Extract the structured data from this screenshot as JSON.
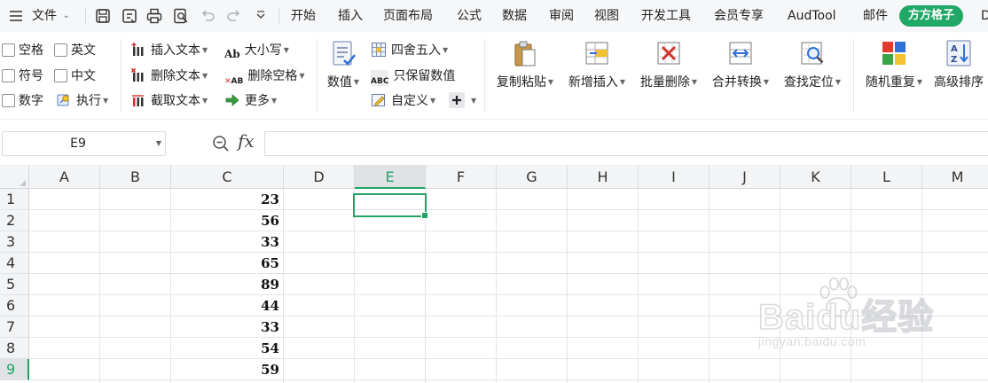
{
  "menubar": {
    "file_menu_label": "文件",
    "tabs": [
      {
        "label": "开始"
      },
      {
        "label": "插入"
      },
      {
        "label": "页面布局"
      },
      {
        "label": "公式"
      },
      {
        "label": "数据"
      },
      {
        "label": "审阅"
      },
      {
        "label": "视图"
      },
      {
        "label": "开发工具"
      },
      {
        "label": "会员专享"
      },
      {
        "label": "AudTool"
      },
      {
        "label": "邮件"
      }
    ],
    "active_tab": "方方格子",
    "cut_tab_fragment": "D",
    "icons": [
      "hamburger-icon",
      "save-icon",
      "export-icon",
      "print-icon",
      "print-preview-icon",
      "undo-icon",
      "redo-icon",
      "customize-icon"
    ]
  },
  "ribbon": {
    "checkboxes": {
      "space": "空格",
      "english": "英文",
      "symbol": "符号",
      "chinese": "中文",
      "number": "数字"
    },
    "execute": "执行",
    "text_group": {
      "insert_text": "插入文本",
      "delete_text": "删除文本",
      "extract_text": "截取文本"
    },
    "case_group": {
      "case": "大小写",
      "delete_space": "删除空格",
      "more": "更多"
    },
    "number_button": "数值",
    "number_group": {
      "round": "四舍五入",
      "keep_numbers": "只保留数值",
      "custom": "自定义"
    },
    "big_buttons": {
      "copy_paste": "复制粘贴",
      "add_insert": "新增插入",
      "batch_delete": "批量删除",
      "merge_convert": "合并转换",
      "find_locate": "查找定位",
      "random_repeat": "随机重复",
      "advanced_sort": "高级排序"
    },
    "icon_labels": {
      "case_icon": "Ab",
      "delete_space_icon": "AB",
      "keep_numbers_icon": "ABC"
    }
  },
  "formula_bar": {
    "name_box": "E9",
    "fx_label": "fx",
    "formula_value": ""
  },
  "grid": {
    "columns": [
      "A",
      "B",
      "C",
      "D",
      "E",
      "F",
      "G",
      "H",
      "I",
      "J",
      "K",
      "L",
      "M"
    ],
    "active_column": "E",
    "rows": [
      "1",
      "2",
      "3",
      "4",
      "5",
      "6",
      "7",
      "8",
      "9"
    ],
    "active_row": "9",
    "column_c_values": [
      "23",
      "56",
      "33",
      "65",
      "89",
      "44",
      "33",
      "54",
      "59"
    ],
    "selected_cell": "E9"
  },
  "watermark": {
    "main": "Baidu经验",
    "sub": "jingyan.baidu.com"
  },
  "colors": {
    "accent_green": "#21a366",
    "pill_green": "#20a867"
  }
}
